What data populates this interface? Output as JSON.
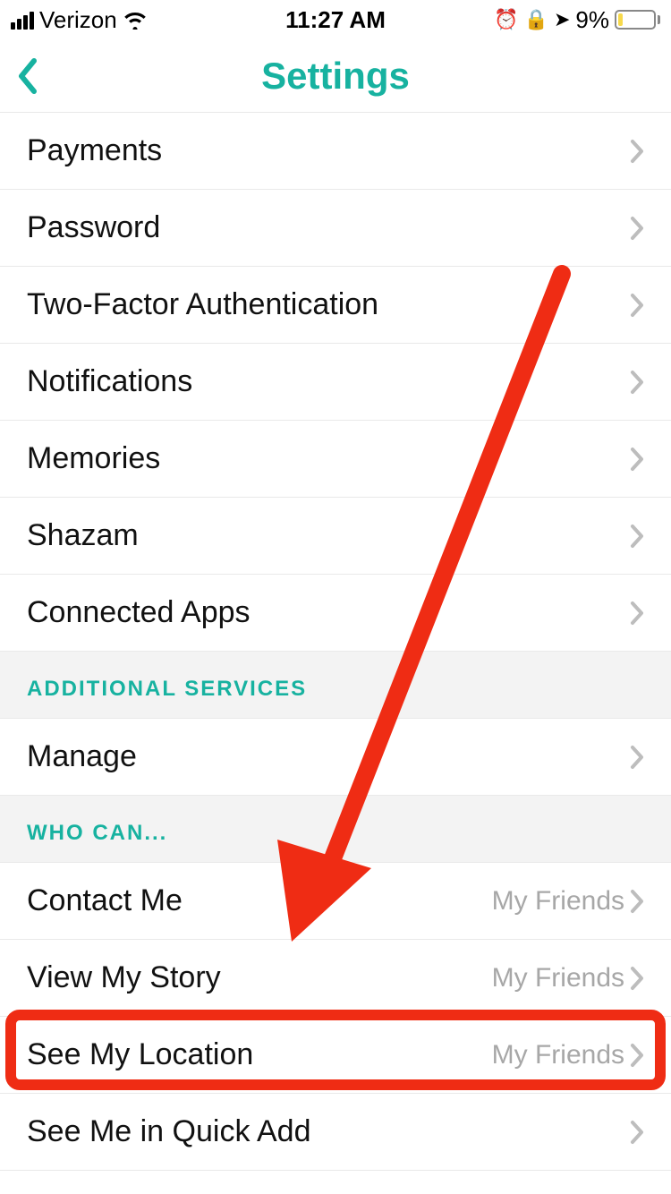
{
  "status_bar": {
    "carrier": "Verizon",
    "time": "11:27 AM",
    "battery_percent": "9%"
  },
  "header": {
    "title": "Settings"
  },
  "sections": [
    {
      "id": "sec0",
      "header": null,
      "rows": [
        {
          "id": "payments",
          "label": "Payments",
          "value": null
        },
        {
          "id": "password",
          "label": "Password",
          "value": null
        },
        {
          "id": "two-factor",
          "label": "Two-Factor Authentication",
          "value": null
        },
        {
          "id": "notifications",
          "label": "Notifications",
          "value": null
        },
        {
          "id": "memories",
          "label": "Memories",
          "value": null
        },
        {
          "id": "shazam",
          "label": "Shazam",
          "value": null
        },
        {
          "id": "connected",
          "label": "Connected Apps",
          "value": null
        }
      ]
    },
    {
      "id": "sec1",
      "header": "ADDITIONAL SERVICES",
      "rows": [
        {
          "id": "manage",
          "label": "Manage",
          "value": null
        }
      ]
    },
    {
      "id": "sec2",
      "header": "WHO CAN...",
      "rows": [
        {
          "id": "contact-me",
          "label": "Contact Me",
          "value": "My Friends"
        },
        {
          "id": "view-story",
          "label": "View My Story",
          "value": "My Friends"
        },
        {
          "id": "see-location",
          "label": "See My Location",
          "value": "My Friends"
        },
        {
          "id": "quick-add",
          "label": "See Me in Quick Add",
          "value": null
        }
      ]
    }
  ],
  "annotation": {
    "highlight_row_id": "see-location"
  },
  "colors": {
    "accent": "#17b2a0",
    "annotation": "#ef2c14"
  }
}
